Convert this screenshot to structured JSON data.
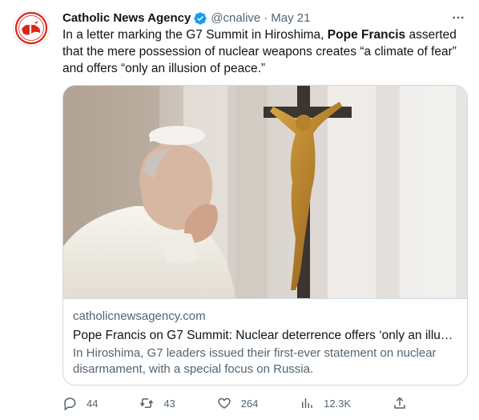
{
  "tweet": {
    "author_name": "Catholic News Agency",
    "handle": "@cnalive",
    "separator": "·",
    "date": "May 21",
    "text_before": "In a letter marking the G7 Summit in Hiroshima, ",
    "text_bold": "Pope Francis",
    "text_after": " asserted that the mere possession of nuclear weapons creates “a climate of fear” and offers “only an illusion of peace.”"
  },
  "card": {
    "domain": "catholicnewsagency.com",
    "title": "Pope Francis on G7 Summit: Nuclear deterrence offers ‘only an illusi...",
    "description": "In Hiroshima, G7 leaders issued their first-ever statement on nuclear disarmament, with a special focus on Russia."
  },
  "actions": {
    "replies": "44",
    "retweets": "43",
    "likes": "264",
    "views": "12.3K"
  },
  "colors": {
    "text_primary": "#0f1419",
    "text_secondary": "#536471",
    "verified_blue": "#1d9bf0",
    "logo_red": "#d9261c",
    "border": "#cfd9de"
  },
  "icons": {
    "avatar": "catholic-news-agency-logo",
    "verified": "verified-badge-icon",
    "more": "more-icon",
    "reply": "reply-icon",
    "retweet": "retweet-icon",
    "like": "heart-icon",
    "views": "views-icon",
    "share": "share-icon"
  }
}
